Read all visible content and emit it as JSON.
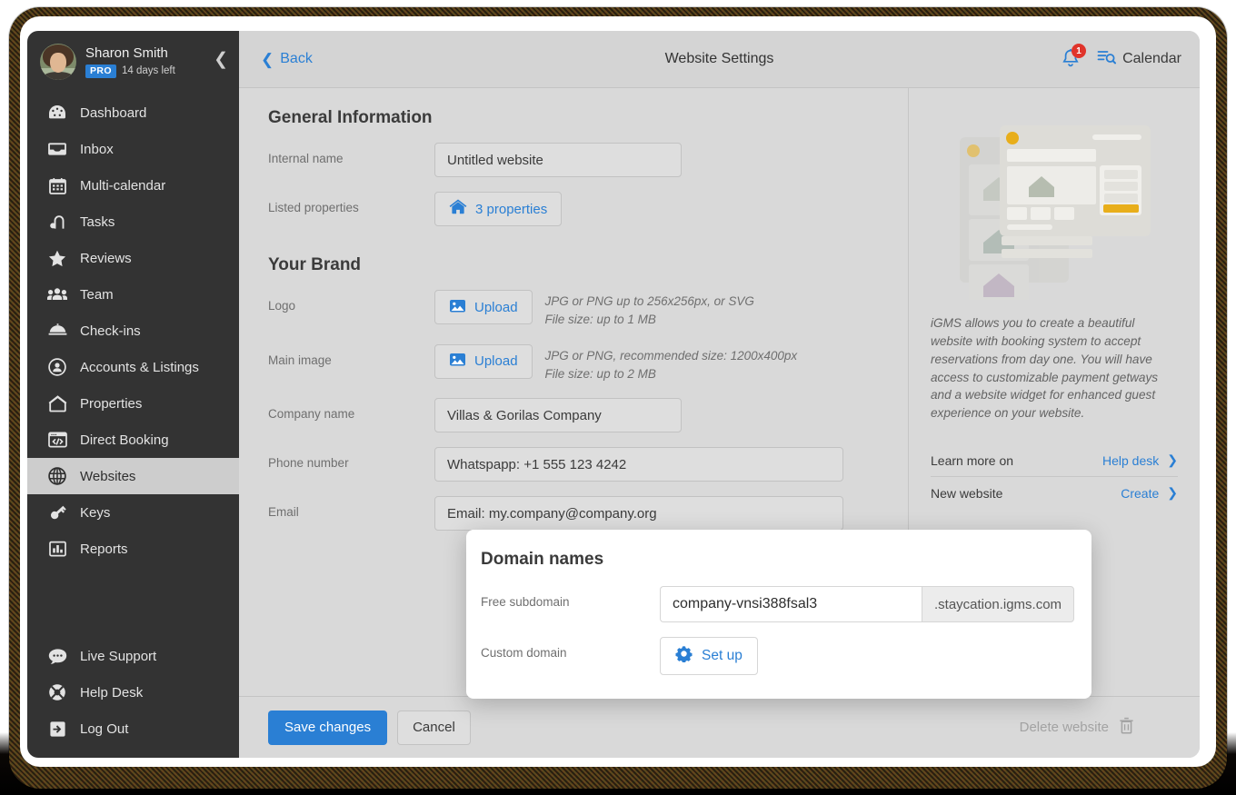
{
  "sidebar": {
    "user": {
      "name": "Sharon Smith",
      "plan_badge": "PRO",
      "trial": "14 days left",
      "avatar_name": "user-avatar",
      "collapse_icon": "chevron-left-icon"
    },
    "items": [
      {
        "label": "Dashboard",
        "icon": "dashboard-icon",
        "active": false
      },
      {
        "label": "Inbox",
        "icon": "inbox-icon",
        "active": false
      },
      {
        "label": "Multi-calendar",
        "icon": "calendar-icon",
        "active": false
      },
      {
        "label": "Tasks",
        "icon": "tasks-icon",
        "active": false
      },
      {
        "label": "Reviews",
        "icon": "star-icon",
        "active": false
      },
      {
        "label": "Team",
        "icon": "team-icon",
        "active": false
      },
      {
        "label": "Check-ins",
        "icon": "bell-desk-icon",
        "active": false
      },
      {
        "label": "Accounts & Listings",
        "icon": "account-circle-icon",
        "active": false
      },
      {
        "label": "Properties",
        "icon": "home-icon",
        "active": false
      },
      {
        "label": "Direct Booking",
        "icon": "code-window-icon",
        "active": false
      },
      {
        "label": "Websites",
        "icon": "globe-icon",
        "active": true
      },
      {
        "label": "Keys",
        "icon": "key-icon",
        "active": false
      },
      {
        "label": "Reports",
        "icon": "bar-chart-icon",
        "active": false
      }
    ],
    "bottom_items": [
      {
        "label": "Live Support",
        "icon": "chat-bubble-icon"
      },
      {
        "label": "Help Desk",
        "icon": "lifebuoy-icon"
      },
      {
        "label": "Log Out",
        "icon": "logout-icon"
      }
    ]
  },
  "topbar": {
    "back_label": "Back",
    "back_icon": "chevron-left-icon",
    "title": "Website Settings",
    "bell_icon": "notification-bell-icon",
    "bell_count": "1",
    "calendar_label": "Calendar",
    "calendar_icon": "calendar-search-icon"
  },
  "form": {
    "general_title": "General Information",
    "brand_title": "Your Brand",
    "internal_name": {
      "label": "Internal name",
      "value": "Untitled website",
      "placeholder": "Internal name"
    },
    "listed_properties": {
      "label": "Listed properties",
      "button": "3 properties",
      "icon": "home-icon"
    },
    "logo": {
      "label": "Logo",
      "button": "Upload",
      "icon": "image-icon",
      "hint_line1": "JPG or PNG up to 256x256px, or SVG",
      "hint_line2": "File size: up to 1 MB"
    },
    "main_image": {
      "label": "Main image",
      "button": "Upload",
      "icon": "image-icon",
      "hint_line1": "JPG or PNG, recommended size: 1200x400px",
      "hint_line2": "File size: up to 2 MB"
    },
    "company_name": {
      "label": "Company name",
      "value": "Villas & Gorilas Company",
      "placeholder": "Company name"
    },
    "phone_number": {
      "label": "Phone number",
      "value": "Whatspapp: +1 555 123 4242",
      "placeholder": "Phone number"
    },
    "email": {
      "label": "Email",
      "value": "Email: my.company@company.org",
      "placeholder": "Email"
    }
  },
  "modal": {
    "title": "Domain names",
    "free_subdomain": {
      "label": "Free subdomain",
      "value": "company-vnsi388fsal3",
      "placeholder": "subdomain",
      "suffix": ".staycation.igms.com"
    },
    "custom_domain": {
      "label": "Custom domain",
      "button": "Set up",
      "icon": "gear-icon"
    }
  },
  "footer": {
    "save_label": "Save changes",
    "cancel_label": "Cancel",
    "delete_label": "Delete website",
    "delete_icon": "trash-icon"
  },
  "panel": {
    "illustration_name": "website-builder-illustration",
    "description": "iGMS allows you to create a beautiful website with booking system to accept reservations from day one. You will have access to customizable payment getways and a website widget for enhanced guest experience on your website.",
    "rows": [
      {
        "label": "Learn more on",
        "link": "Help desk",
        "chevron": "chevron-right-icon"
      },
      {
        "label": "New website",
        "link": "Create",
        "chevron": "chevron-right-icon"
      }
    ]
  },
  "colors": {
    "accent": "#2a7fd4",
    "sidebar_bg": "#333333",
    "app_bg": "#d9d9d9",
    "badge_red": "#e0342b",
    "illustration_gold": "#e8ae1a"
  }
}
